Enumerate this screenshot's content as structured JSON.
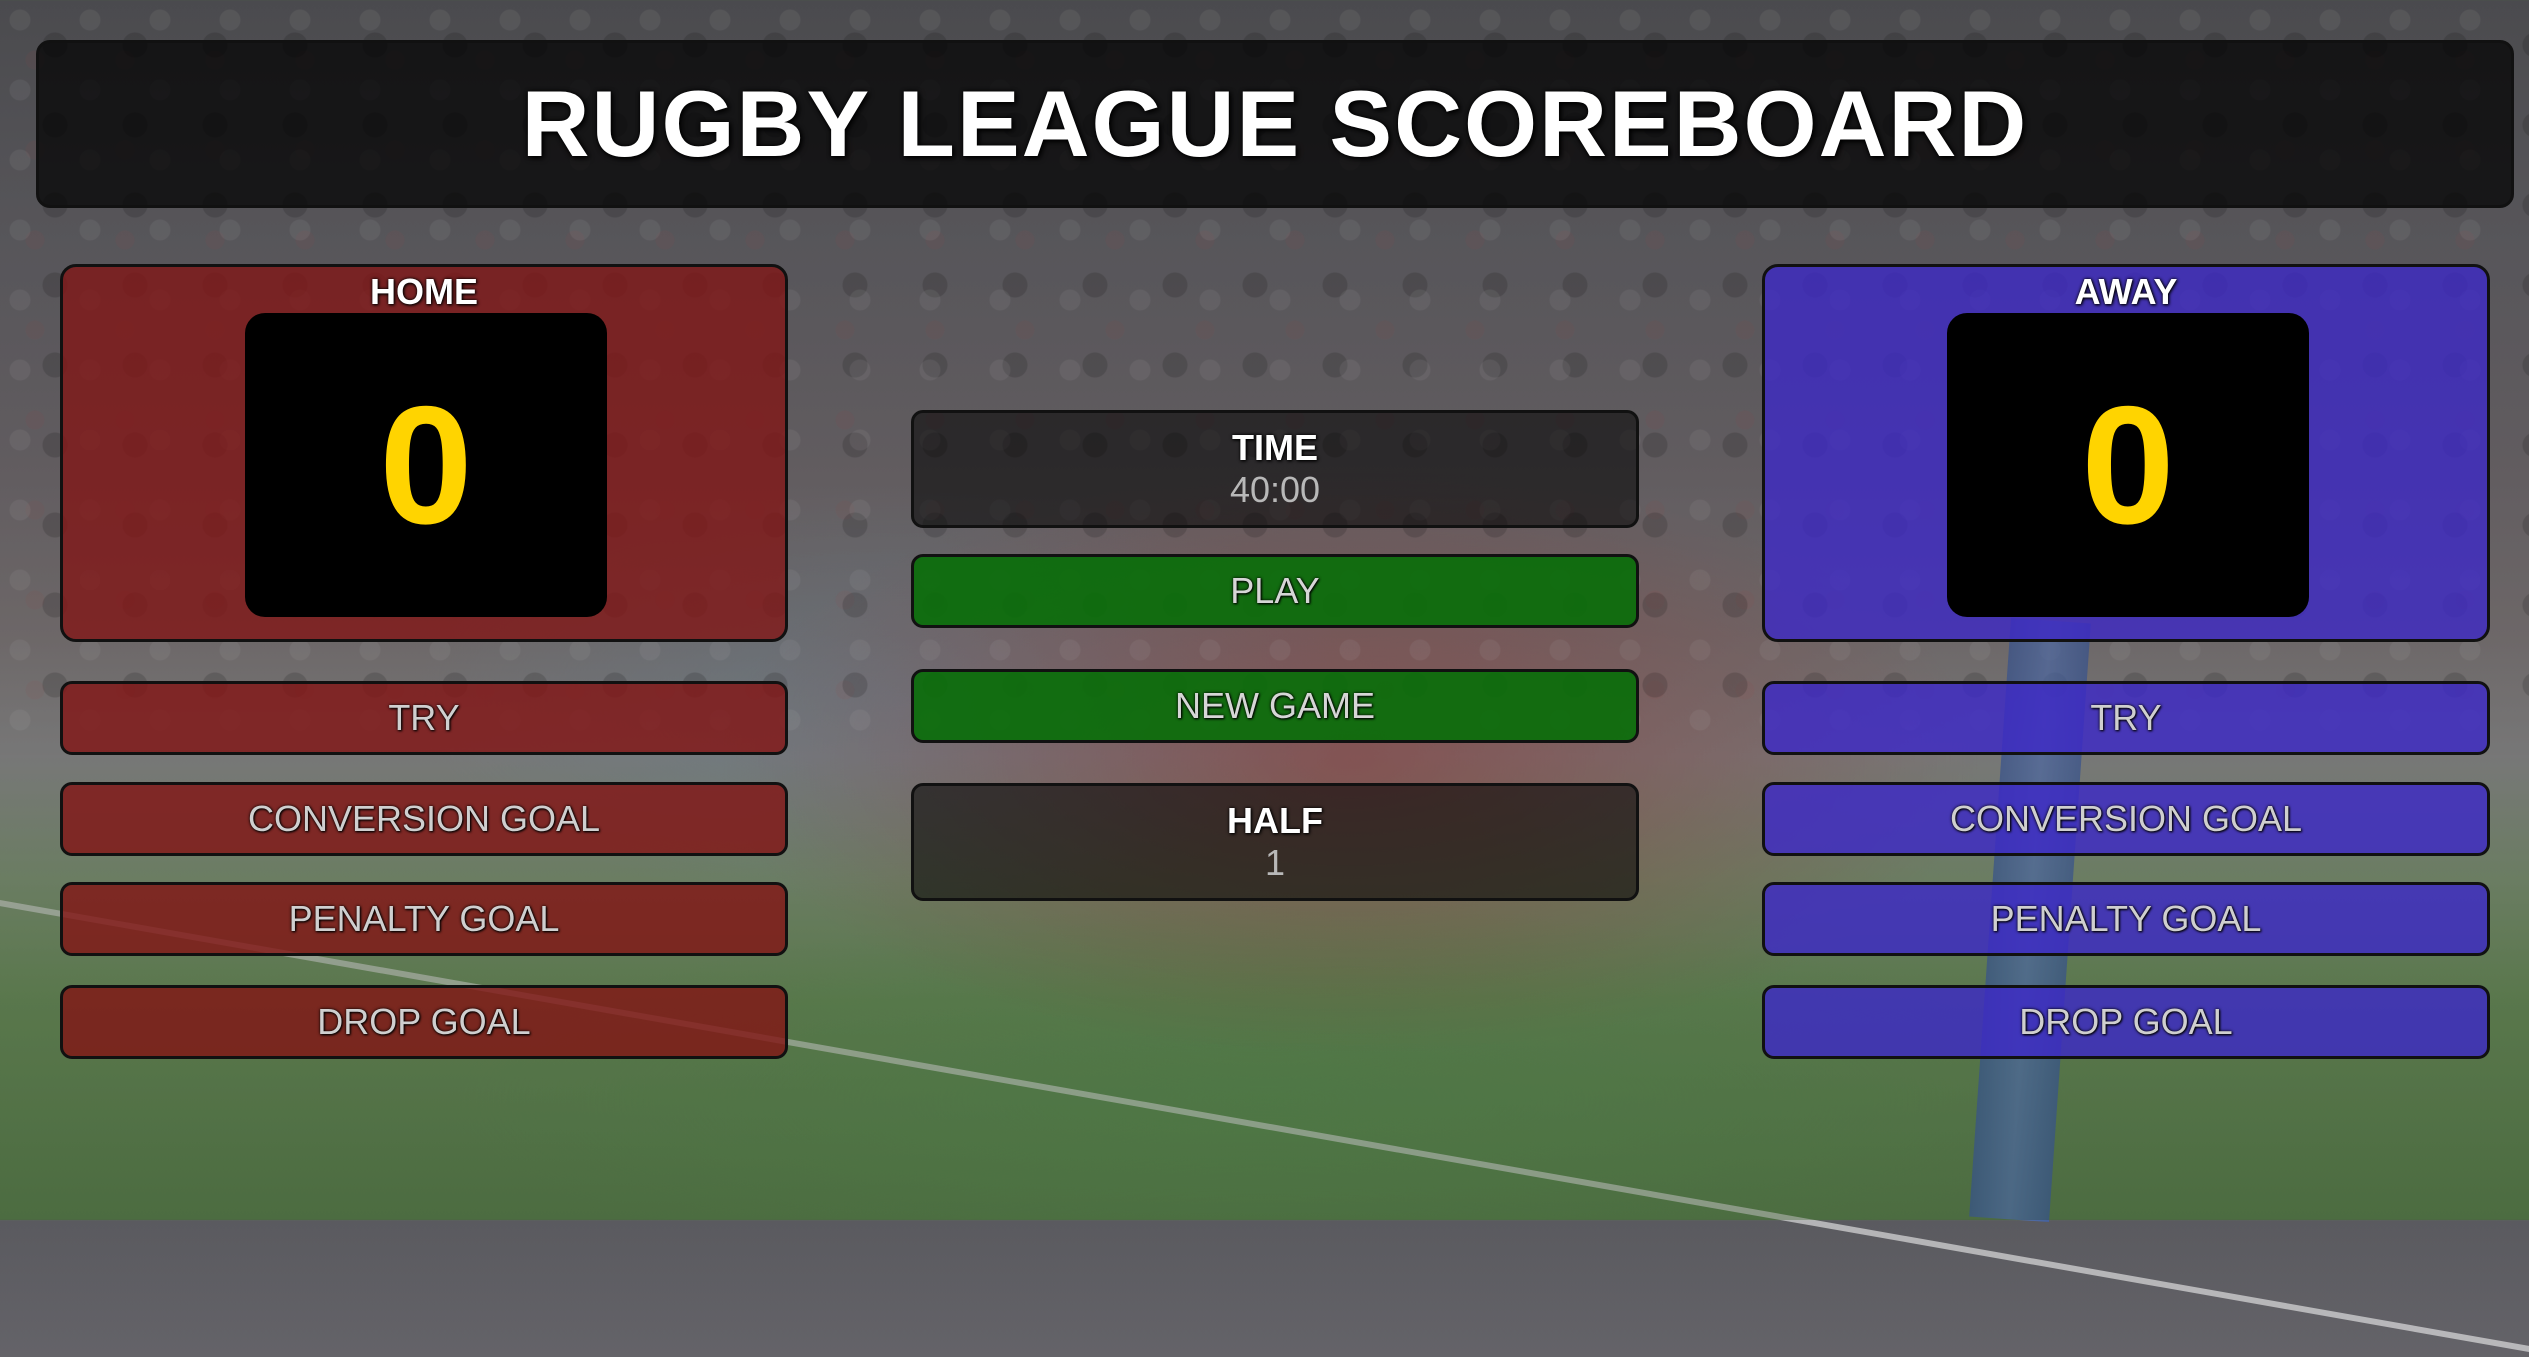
{
  "title": "RUGBY LEAGUE SCOREBOARD",
  "colors": {
    "home_panel": "#821414",
    "away_panel": "#3c28c8",
    "score_digits": "#ffd400",
    "action_green": "#0a6e0a"
  },
  "home": {
    "name": "HOME",
    "score": "0",
    "buttons": {
      "try": "TRY",
      "conversion": "CONVERSION GOAL",
      "penalty": "PENALTY GOAL",
      "drop": "DROP GOAL"
    }
  },
  "away": {
    "name": "AWAY",
    "score": "0",
    "buttons": {
      "try": "TRY",
      "conversion": "CONVERSION GOAL",
      "penalty": "PENALTY GOAL",
      "drop": "DROP GOAL"
    }
  },
  "center": {
    "time_label": "TIME",
    "time_value": "40:00",
    "play_label": "PLAY",
    "new_game_label": "NEW GAME",
    "half_label": "HALF",
    "half_value": "1"
  }
}
